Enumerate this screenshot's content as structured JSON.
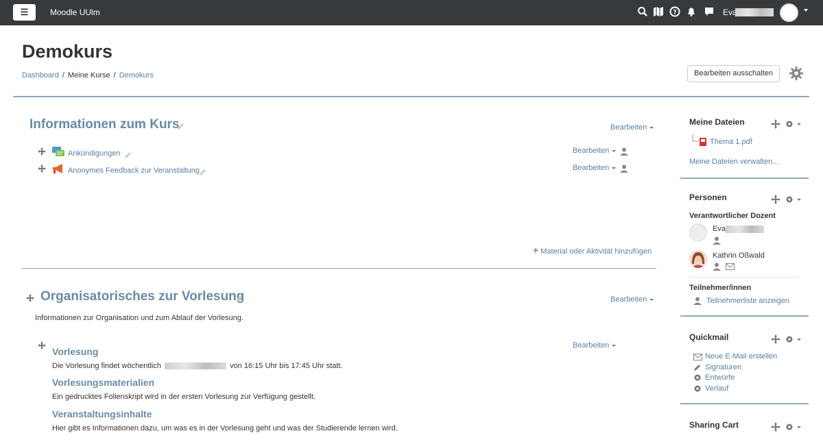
{
  "navbar": {
    "site_name": "Moodle UUlm",
    "user_name": "Eva",
    "icons": [
      "search-icon",
      "map-icon",
      "help-icon",
      "bell-icon",
      "chat-icon"
    ]
  },
  "header": {
    "title": "Demokurs",
    "breadcrumb": [
      "Dashboard",
      "Meine Kurse",
      "Demokurs"
    ],
    "edit_button": "Bearbeiten ausschalten"
  },
  "section1": {
    "title": "Informationen zum Kurs",
    "edit_label": "Bearbeiten",
    "activities": [
      {
        "label": "Ankündigungen",
        "edit": "Bearbeiten",
        "icon": "forum-icon"
      },
      {
        "label": "Anonymes Feedback zur Veranstaltung",
        "edit": "Bearbeiten",
        "icon": "feedback-icon"
      }
    ],
    "add_material": "Material oder Aktivität hinzufügen"
  },
  "section2": {
    "title": "Organisatorisches zur Vorlesung",
    "edit_label": "Bearbeiten",
    "summary": "Informationen zur Organisation und zum Ablauf der Vorlesung.",
    "label_edit": "Bearbeiten",
    "items": [
      {
        "title": "Vorlesung",
        "text_before": "Die Vorlesung findet wöchentlich",
        "text_after": "von 16:15 Uhr bis 17:45 Uhr statt."
      },
      {
        "title": "Vorlesungsmaterialien",
        "text": "Ein gedrucktes Folienskript wird in der ersten Vorlesung zur Verfügung gestellt."
      },
      {
        "title": "Veranstaltungsinhalte",
        "text": "Hier gibt es Informationen dazu, um was es in der Vorlesung geht und was der Studierende lernen wird."
      }
    ]
  },
  "blocks": {
    "files": {
      "title": "Meine Dateien",
      "file": "Thema 1.pdf",
      "manage": "Meine Dateien verwalten..."
    },
    "people": {
      "title": "Personen",
      "role": "Verantwortlicher Dozent",
      "persons": [
        "Eva",
        "Kathrin Oßwald"
      ],
      "participants_heading": "Teilnehmer/innen",
      "participants_link": "Teilnehmerliste anzeigen"
    },
    "quickmail": {
      "title": "Quickmail",
      "links": [
        "Neue E-Mail erstellen",
        "Signaturen",
        "Entwürfe",
        "Verlauf"
      ]
    },
    "sharing": {
      "title": "Sharing Cart"
    }
  },
  "colors": {
    "navbar": "#373a3c",
    "link": "#5a7fa3",
    "section_title": "#6b8aa5",
    "divider": "#8ea9b9"
  }
}
